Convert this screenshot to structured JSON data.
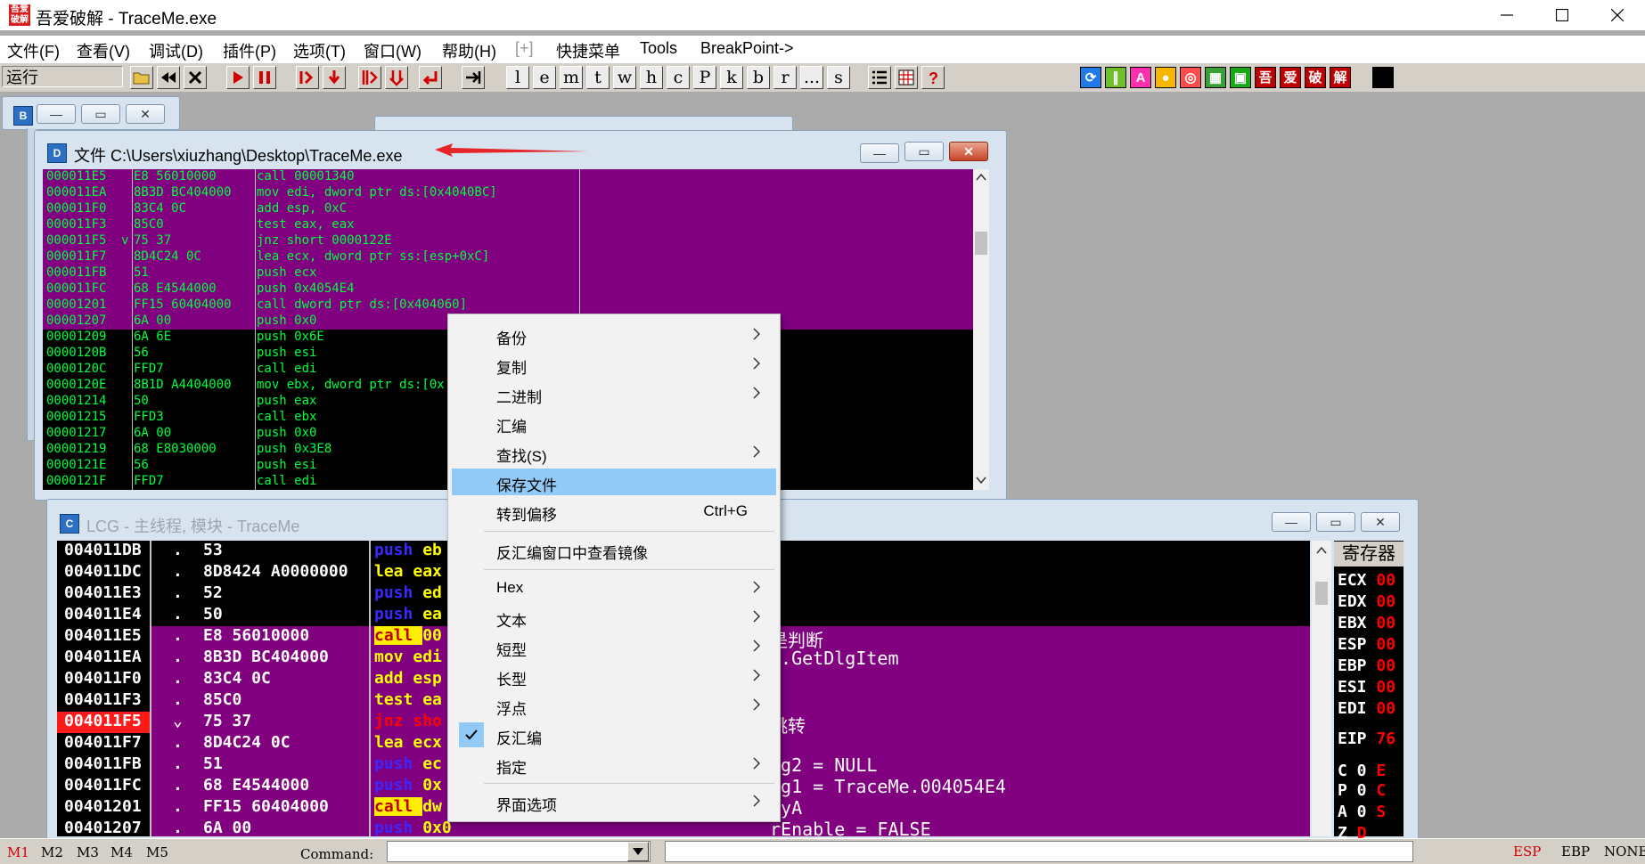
{
  "window": {
    "logo_text": "吾爱破解",
    "title": "吾爱破解 - TraceMe.exe"
  },
  "menu": [
    {
      "label": "文件(F)"
    },
    {
      "label": "查看(V)"
    },
    {
      "label": "调试(D)"
    },
    {
      "label": "插件(P)"
    },
    {
      "label": "选项(T)"
    },
    {
      "label": "窗口(W)"
    },
    {
      "label": "帮助(H)"
    },
    {
      "label": "[+]"
    },
    {
      "label": "快捷菜单"
    },
    {
      "label": "Tools"
    },
    {
      "label": "BreakPoint->"
    }
  ],
  "toolbar": {
    "status": "运行",
    "letters": [
      "l",
      "e",
      "m",
      "t",
      "w",
      "h",
      "c",
      "P",
      "k",
      "b",
      "r",
      "...",
      "s"
    ],
    "plugins": [
      "吾",
      "爱",
      "破",
      "解"
    ]
  },
  "file_window": {
    "title": "文件 C:\\Users\\xiuzhang\\Desktop\\TraceMe.exe",
    "rows": [
      {
        "addr": "000011E5",
        "hex": "E8 56010000",
        "asm": "call 00001340",
        "bg": "purple"
      },
      {
        "addr": "000011EA",
        "hex": "8B3D BC404000",
        "asm": "mov edi, dword ptr ds:[0x4040BC]",
        "bg": "purple"
      },
      {
        "addr": "000011F0",
        "hex": "83C4 0C",
        "asm": "add esp, 0xC",
        "bg": "purple"
      },
      {
        "addr": "000011F3",
        "hex": "85C0",
        "asm": "test eax, eax",
        "bg": "purple"
      },
      {
        "addr": "000011F5",
        "hex": "75 37",
        "asm": "jnz short 0000122E",
        "bg": "purple",
        "jmp": "v"
      },
      {
        "addr": "000011F7",
        "hex": "8D4C24 0C",
        "asm": "lea ecx, dword ptr ss:[esp+0xC]",
        "bg": "purple"
      },
      {
        "addr": "000011FB",
        "hex": "51",
        "asm": "push ecx",
        "bg": "purple"
      },
      {
        "addr": "000011FC",
        "hex": "68 E4544000",
        "asm": "push 0x4054E4",
        "bg": "purple"
      },
      {
        "addr": "00001201",
        "hex": "FF15 60404000",
        "asm": "call dword ptr ds:[0x404060]",
        "bg": "purple"
      },
      {
        "addr": "00001207",
        "hex": "6A 00",
        "asm": "push 0x0",
        "bg": "purple"
      },
      {
        "addr": "00001209",
        "hex": "6A 6E",
        "asm": "push 0x6E",
        "bg": "black"
      },
      {
        "addr": "0000120B",
        "hex": "56",
        "asm": "push esi",
        "bg": "black"
      },
      {
        "addr": "0000120C",
        "hex": "FFD7",
        "asm": "call edi",
        "bg": "black"
      },
      {
        "addr": "0000120E",
        "hex": "8B1D A4404000",
        "asm": "mov ebx, dword ptr ds:[0x",
        "bg": "black"
      },
      {
        "addr": "00001214",
        "hex": "50",
        "asm": "push eax",
        "bg": "black"
      },
      {
        "addr": "00001215",
        "hex": "FFD3",
        "asm": "call ebx",
        "bg": "black"
      },
      {
        "addr": "00001217",
        "hex": "6A 00",
        "asm": "push 0x0",
        "bg": "black"
      },
      {
        "addr": "00001219",
        "hex": "68 E8030000",
        "asm": "push 0x3E8",
        "bg": "black"
      },
      {
        "addr": "0000121E",
        "hex": "56",
        "asm": "push esi",
        "bg": "black"
      },
      {
        "addr": "0000121F",
        "hex": "FFD7",
        "asm": "call edi",
        "bg": "black"
      }
    ]
  },
  "cpu_window": {
    "title": "LCG - 主线程, 模块 - TraceMe",
    "registers_title": "寄存器",
    "rows": [
      {
        "addr": "004011DB",
        "mark": ".",
        "hex": "53",
        "mn": "push",
        "op": "eb",
        "kind": "push",
        "bg": "black"
      },
      {
        "addr": "004011DC",
        "mark": ".",
        "hex": "8D8424 A0000000",
        "mn": "lea",
        "op": "eax",
        "kind": "fg",
        "bg": "black"
      },
      {
        "addr": "004011E3",
        "mark": ".",
        "hex": "52",
        "mn": "push",
        "op": "ed",
        "kind": "push",
        "bg": "black"
      },
      {
        "addr": "004011E4",
        "mark": ".",
        "hex": "50",
        "mn": "push",
        "op": "ea",
        "kind": "push",
        "bg": "black"
      },
      {
        "addr": "004011E5",
        "mark": ".",
        "hex": "E8 56010000",
        "mn": "call",
        "op": "00",
        "kind": "call",
        "bg": "purple",
        "cmt": "是判断"
      },
      {
        "addr": "004011EA",
        "mark": ".",
        "hex": "8B3D BC404000",
        "mn": "mov",
        "op": "edi",
        "kind": "fg",
        "bg": "purple",
        "cmt": "2.GetDlgItem"
      },
      {
        "addr": "004011F0",
        "mark": ".",
        "hex": "83C4 0C",
        "mn": "add",
        "op": "esp",
        "kind": "fg",
        "bg": "purple"
      },
      {
        "addr": "004011F3",
        "mark": ".",
        "hex": "85C0",
        "mn": "test",
        "op": "ea",
        "kind": "fg",
        "bg": "purple"
      },
      {
        "addr": "004011F5",
        "mark": "⌄",
        "hex": "75 37",
        "mn": "jnz",
        "op": "sho",
        "kind": "jmp",
        "bg": "purple",
        "cmt": "跳转",
        "red": true
      },
      {
        "addr": "004011F7",
        "mark": ".",
        "hex": "8D4C24 0C",
        "mn": "lea",
        "op": "ecx",
        "kind": "fg",
        "bg": "purple"
      },
      {
        "addr": "004011FB",
        "mark": ".",
        "hex": "51",
        "mn": "push",
        "op": "ec",
        "kind": "push",
        "bg": "purple",
        "cmt": "ng2 = NULL"
      },
      {
        "addr": "004011FC",
        "mark": ".",
        "hex": "68 E4544000",
        "mn": "push",
        "op": "0x",
        "kind": "push",
        "bg": "purple",
        "cmt": "ng1 = TraceMe.004054E4"
      },
      {
        "addr": "00401201",
        "mark": ".",
        "hex": "FF15 60404000",
        "mn": "call",
        "op": "dw",
        "kind": "call",
        "bg": "purple",
        "cmt": "pyA"
      },
      {
        "addr": "00401207",
        "mark": ".",
        "hex": "6A 00",
        "mn": "push",
        "op": "0x0",
        "kind": "push",
        "bg": "purple",
        "cmt": "rEnable = FALSE"
      }
    ],
    "registers": [
      {
        "name": "ECX",
        "val": "00"
      },
      {
        "name": "EDX",
        "val": "00"
      },
      {
        "name": "EBX",
        "val": "00"
      },
      {
        "name": "ESP",
        "val": "00"
      },
      {
        "name": "EBP",
        "val": "00"
      },
      {
        "name": "ESI",
        "val": "00"
      },
      {
        "name": "EDI",
        "val": "00"
      },
      {
        "name": "EIP",
        "val": "76"
      },
      {
        "name": "C 0",
        "val": "E"
      },
      {
        "name": "P 0",
        "val": "C"
      },
      {
        "name": "A 0",
        "val": "S"
      },
      {
        "name": "Z",
        "val": "D"
      }
    ]
  },
  "context_menu": {
    "items": [
      {
        "label": "备份",
        "submenu": true
      },
      {
        "label": "复制",
        "submenu": true
      },
      {
        "label": "二进制",
        "submenu": true
      },
      {
        "label": "汇编",
        "submenu": false
      },
      {
        "label": "查找(S)",
        "submenu": true
      },
      {
        "label": "保存文件",
        "submenu": false,
        "highlighted": true
      },
      {
        "label": "转到偏移",
        "submenu": false,
        "shortcut": "Ctrl+G"
      },
      {
        "label": "反汇编窗口中查看镜像",
        "submenu": false
      },
      {
        "label": "Hex",
        "submenu": true
      },
      {
        "label": "文本",
        "submenu": true
      },
      {
        "label": "短型",
        "submenu": true
      },
      {
        "label": "长型",
        "submenu": true
      },
      {
        "label": "浮点",
        "submenu": true
      },
      {
        "label": "反汇编",
        "submenu": false,
        "checked": true
      },
      {
        "label": "指定",
        "submenu": true
      },
      {
        "label": "界面选项",
        "submenu": true
      }
    ]
  },
  "statusbar": {
    "tabs": [
      "M1",
      "M2",
      "M3",
      "M4",
      "M5"
    ],
    "command_label": "Command:",
    "command_value": "",
    "regs": [
      "ESP",
      "EBP",
      "NONE"
    ]
  },
  "colors": {
    "disasm_bg": "#800080",
    "disasm_text": "#00ff3c",
    "highlight": "#91c9f7",
    "accent_red": "#ff1a1a"
  }
}
